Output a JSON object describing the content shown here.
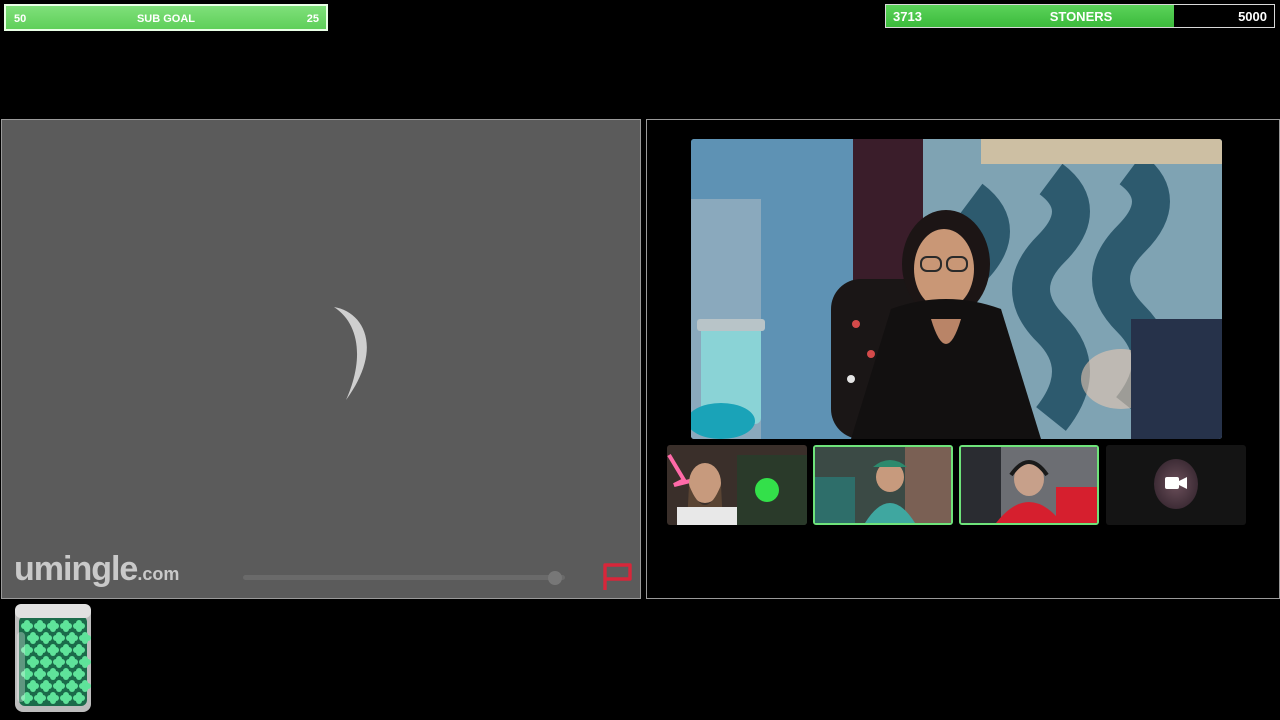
{
  "sub_goal": {
    "current": "50",
    "label": "SUB GOAL",
    "target": "25"
  },
  "stoners_goal": {
    "current": "3713",
    "label": "STONERS",
    "target": "5000",
    "progress": 0.7426
  },
  "stranger_panel": {
    "brand_name": "umingle",
    "brand_tld": ".com",
    "status": "loading",
    "volume_level": 0.97
  },
  "group_call": {
    "participants": [
      {
        "name": "",
        "state": "video"
      },
      {
        "name": "",
        "state": "video",
        "active": true
      },
      {
        "name": "",
        "state": "video"
      },
      {
        "name": "",
        "state": "camera-off"
      }
    ]
  },
  "colors": {
    "goal_green": "#5fcf5a",
    "active_border": "#6ee37a",
    "panel_grey": "#5b5b5b",
    "report_red": "#d8263a"
  },
  "icons": [
    "loading-spinner-icon",
    "report-flag-icon",
    "camera-icon",
    "clover-jar-icon"
  ]
}
